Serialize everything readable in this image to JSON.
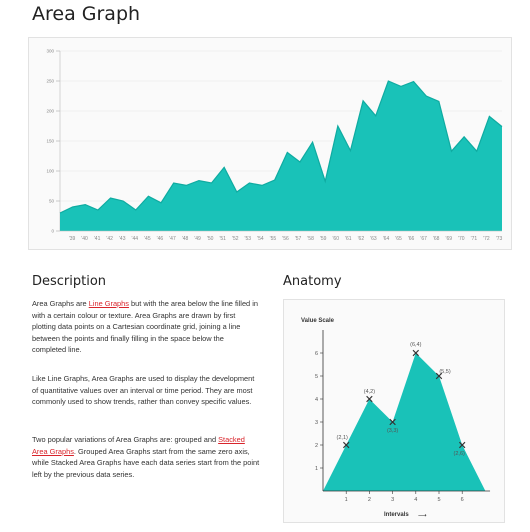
{
  "page": {
    "title": "Area Graph"
  },
  "description": {
    "heading": "Description",
    "p1_before": "Area Graphs are ",
    "p1_link": "Line Graphs",
    "p1_after": " but with the area below the line filled in with a certain colour or texture. Area Graphs are drawn by first plotting data points on a Cartesian coordinate grid, joining a line between the points and finally filling in the space below the completed line.",
    "p2": "Like Line Graphs, Area Graphs are used to display the development of quantitative values over an interval or time period. They are most commonly used to show trends, rather than convey specific values.",
    "p3_before": "Two popular variations of Area Graphs are: grouped and ",
    "p3_link": "Stacked Area Graphs",
    "p3_after": ". Grouped Area Graphs start from the same zero axis, while Stacked Area Graphs have each data series start from the point left by the previous data series."
  },
  "anatomy": {
    "heading": "Anatomy",
    "value_scale_label": "Value Scale",
    "intervals_label": "Intervals",
    "arrow": "⟶",
    "y_ticks": [
      "1",
      "2",
      "3",
      "4",
      "5",
      "6"
    ],
    "x_ticks": [
      "1",
      "2",
      "3",
      "4",
      "5",
      "6"
    ],
    "points": [
      {
        "x": 1,
        "y": 2,
        "label": "(2,1)"
      },
      {
        "x": 2,
        "y": 4,
        "label": "(4,2)"
      },
      {
        "x": 3,
        "y": 3,
        "label": "(3,3)"
      },
      {
        "x": 4,
        "y": 6,
        "label": "(6,4)"
      },
      {
        "x": 5,
        "y": 5,
        "label": "(5,5)"
      },
      {
        "x": 6,
        "y": 2,
        "label": "(2,6)"
      }
    ],
    "colors": {
      "fill": "#19c2b8",
      "marker": "#333333"
    }
  },
  "chart_data": {
    "type": "area",
    "title": "",
    "xlabel": "",
    "ylabel": "",
    "ylim": [
      0,
      300
    ],
    "y_ticks": [
      "0",
      "50",
      "100",
      "150",
      "200",
      "250",
      "300"
    ],
    "x": [
      "'39",
      "'40",
      "'41",
      "'42",
      "'43",
      "'44",
      "'45",
      "'46",
      "'47",
      "'48",
      "'49",
      "'50",
      "'51",
      "'52",
      "'53",
      "'54",
      "'55",
      "'56",
      "'57",
      "'58",
      "'59",
      "'60",
      "'61",
      "'62",
      "'63",
      "'64",
      "'65",
      "'66",
      "'67",
      "'68",
      "'69",
      "'70",
      "'71",
      "'72",
      "'73"
    ],
    "x_tick_labels": [
      "'39",
      "'40",
      "'41",
      "'42",
      "'43",
      "'44",
      "'45",
      "'46",
      "'47",
      "'48",
      "'49",
      "'50",
      "'51",
      "'52",
      "'53",
      "'54",
      "'55",
      "'56",
      "'57",
      "'58",
      "'59",
      "'60",
      "'61",
      "'62",
      "'63",
      "'64",
      "'65",
      "'66",
      "'67",
      "'68",
      "'69",
      "'70",
      "'71",
      "'72",
      "'73"
    ],
    "values": [
      30,
      40,
      44,
      35,
      55,
      50,
      35,
      58,
      47,
      80,
      76,
      84,
      80,
      106,
      65,
      80,
      76,
      85,
      131,
      115,
      148,
      83,
      175,
      134,
      217,
      192,
      250,
      241,
      249,
      225,
      216,
      133,
      157,
      133,
      191,
      174
    ],
    "colors": {
      "fill": "#19c2b8",
      "line": "#0faba1",
      "grid": "#e6e6e6"
    },
    "grid": true
  }
}
